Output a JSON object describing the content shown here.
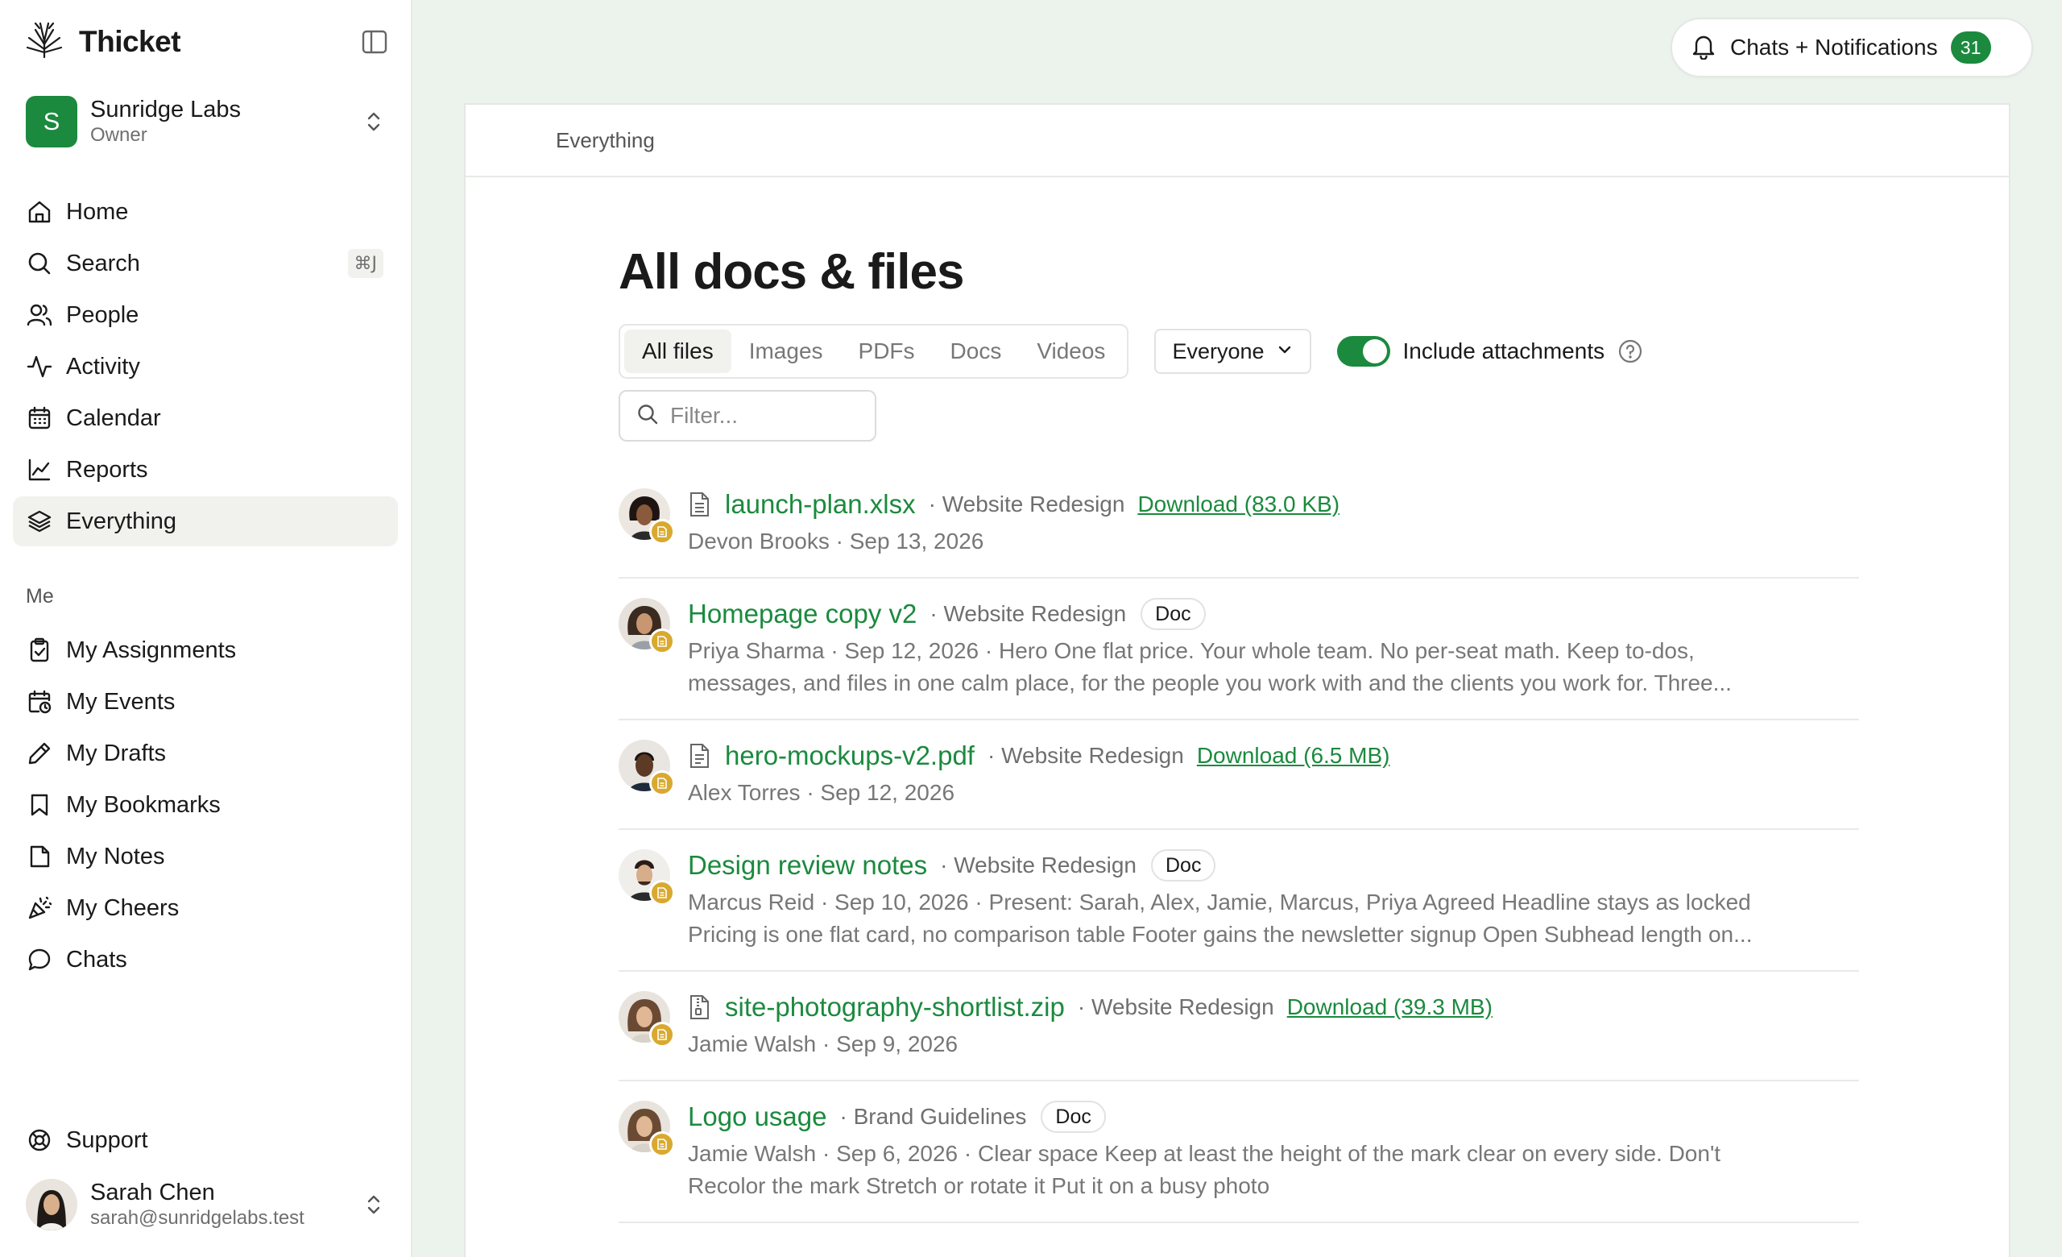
{
  "app": {
    "name": "Thicket"
  },
  "workspace": {
    "name": "Sunridge Labs",
    "role": "Owner",
    "initial": "S"
  },
  "nav": [
    {
      "label": "Home",
      "icon": "home-icon"
    },
    {
      "label": "Search",
      "icon": "search-icon",
      "shortcut": "⌘J"
    },
    {
      "label": "People",
      "icon": "people-icon"
    },
    {
      "label": "Activity",
      "icon": "activity-icon"
    },
    {
      "label": "Calendar",
      "icon": "calendar-icon"
    },
    {
      "label": "Reports",
      "icon": "reports-icon"
    },
    {
      "label": "Everything",
      "icon": "layers-icon",
      "active": true
    }
  ],
  "me_section": {
    "label": "Me",
    "items": [
      {
        "label": "My Assignments",
        "icon": "clipboard-check-icon"
      },
      {
        "label": "My Events",
        "icon": "calendar-clock-icon"
      },
      {
        "label": "My Drafts",
        "icon": "pencil-icon"
      },
      {
        "label": "My Bookmarks",
        "icon": "bookmark-icon"
      },
      {
        "label": "My Notes",
        "icon": "note-icon"
      },
      {
        "label": "My Cheers",
        "icon": "party-popper-icon"
      },
      {
        "label": "Chats",
        "icon": "chat-bubble-icon"
      }
    ]
  },
  "support": {
    "label": "Support",
    "icon": "lifebuoy-icon"
  },
  "user": {
    "name": "Sarah Chen",
    "email": "sarah@sunridgelabs.test"
  },
  "notifications": {
    "label": "Chats + Notifications",
    "count": "31"
  },
  "breadcrumb": "Everything",
  "page": {
    "title": "All docs & files"
  },
  "tabs": [
    {
      "label": "All files",
      "active": true
    },
    {
      "label": "Images"
    },
    {
      "label": "PDFs"
    },
    {
      "label": "Docs"
    },
    {
      "label": "Videos"
    }
  ],
  "people_filter": {
    "value": "Everyone"
  },
  "attachments_toggle": {
    "label": "Include attachments",
    "on": true
  },
  "filter": {
    "placeholder": "Filter...",
    "value": ""
  },
  "colors": {
    "accent": "#1b8a3e",
    "badge_gold": "#d9a92f",
    "bg": "#ecf3ec"
  },
  "files": [
    {
      "title": "launch-plan.xlsx",
      "kind": "file",
      "project": "· Website Redesign",
      "download": "Download (83.0 KB)",
      "meta": "Devon Brooks · Sep 13, 2026"
    },
    {
      "title": "Homepage copy v2",
      "kind": "doc",
      "project": "· Website Redesign",
      "badge": "Doc",
      "meta": "Priya Sharma · Sep 12, 2026 · Hero One flat price. Your whole team. No per-seat math. Keep to-dos,",
      "meta2": "messages, and files in one calm place, for the people you work with and the clients you work for. Three..."
    },
    {
      "title": "hero-mockups-v2.pdf",
      "kind": "file",
      "project": "· Website Redesign",
      "download": "Download (6.5 MB)",
      "meta": "Alex Torres · Sep 12, 2026"
    },
    {
      "title": "Design review notes",
      "kind": "doc",
      "project": "· Website Redesign",
      "badge": "Doc",
      "meta": "Marcus Reid · Sep 10, 2026 · Present: Sarah, Alex, Jamie, Marcus, Priya Agreed Headline stays as locked",
      "meta2": "Pricing is one flat card, no comparison table Footer gains the newsletter signup Open Subhead length on..."
    },
    {
      "title": "site-photography-shortlist.zip",
      "kind": "file",
      "project": "· Website Redesign",
      "download": "Download (39.3 MB)",
      "meta": "Jamie Walsh · Sep 9, 2026"
    },
    {
      "title": "Logo usage",
      "kind": "doc",
      "project": "· Brand Guidelines",
      "badge": "Doc",
      "meta": "Jamie Walsh · Sep 6, 2026 · Clear space Keep at least the height of the mark clear on every side. Don't",
      "meta2": "Recolor the mark Stretch or rotate it Put it on a busy photo"
    }
  ]
}
